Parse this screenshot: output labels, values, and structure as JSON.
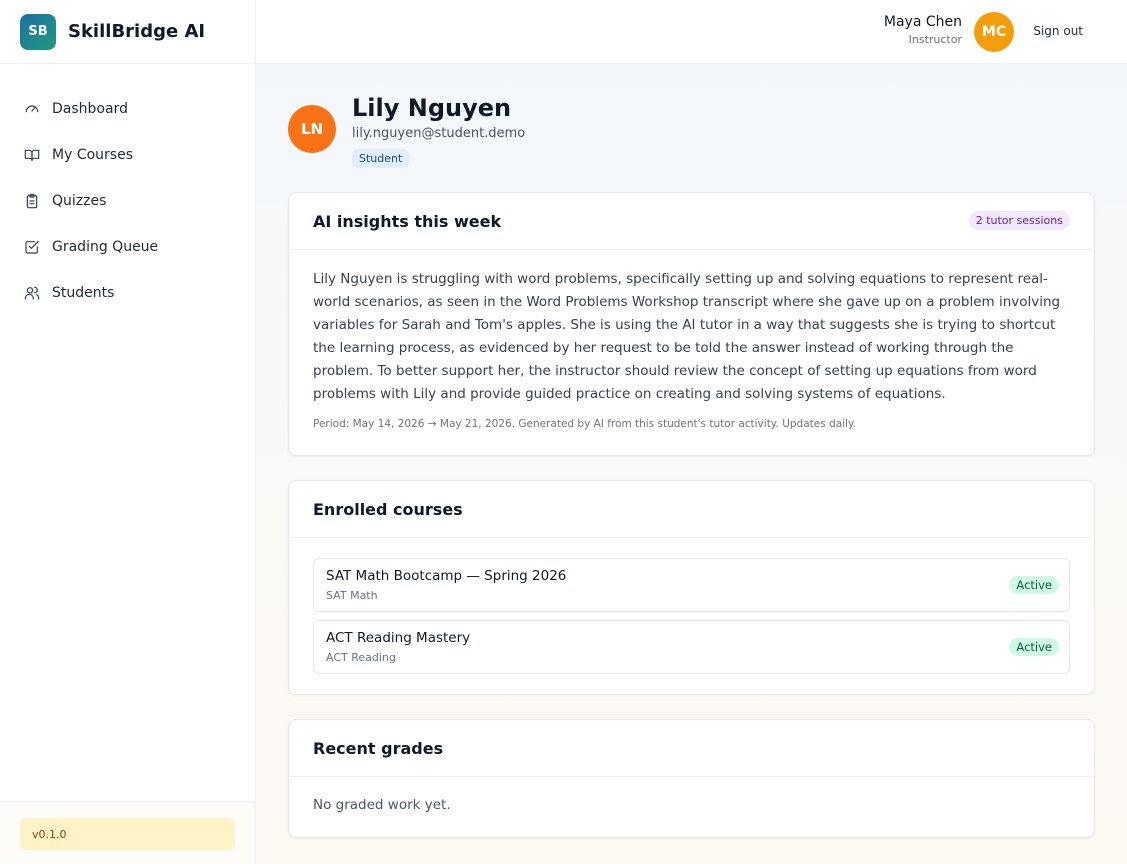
{
  "brand": {
    "logo": "SB",
    "name": "SkillBridge AI"
  },
  "nav": {
    "items": [
      {
        "label": "Dashboard",
        "icon": "gauge-icon"
      },
      {
        "label": "My Courses",
        "icon": "book-icon"
      },
      {
        "label": "Quizzes",
        "icon": "clipboard-icon"
      },
      {
        "label": "Grading Queue",
        "icon": "checkbox-icon"
      },
      {
        "label": "Students",
        "icon": "users-icon"
      }
    ]
  },
  "version": "v0.1.0",
  "header": {
    "user_name": "Maya Chen",
    "user_role": "Instructor",
    "user_initials": "MC",
    "sign_out": "Sign out"
  },
  "student": {
    "initials": "LN",
    "name": "Lily Nguyen",
    "email": "lily.nguyen@student.demo",
    "role_badge": "Student"
  },
  "insights": {
    "title": "AI insights this week",
    "sessions_badge": "2 tutor sessions",
    "body": "Lily Nguyen is struggling with word problems, specifically setting up and solving equations to represent real-world scenarios, as seen in the Word Problems Workshop transcript where she gave up on a problem involving variables for Sarah and Tom's apples. She is using the AI tutor in a way that suggests she is trying to shortcut the learning process, as evidenced by her request to be told the answer instead of working through the problem. To better support her, the instructor should review the concept of setting up equations from word problems with Lily and provide guided practice on creating and solving systems of equations.",
    "meta": "Period: May 14, 2026 → May 21, 2026. Generated by AI from this student's tutor activity. Updates daily."
  },
  "courses": {
    "title": "Enrolled courses",
    "items": [
      {
        "name": "SAT Math Bootcamp — Spring 2026",
        "subject": "SAT Math",
        "status": "Active"
      },
      {
        "name": "ACT Reading Mastery",
        "subject": "ACT Reading",
        "status": "Active"
      }
    ]
  },
  "grades": {
    "title": "Recent grades",
    "empty": "No graded work yet."
  },
  "colors": {
    "student_avatar": "#f97316",
    "user_avatar": "#f59e0b",
    "active_badge": "#d1fae5",
    "sessions_badge": "#f1e8fd"
  }
}
